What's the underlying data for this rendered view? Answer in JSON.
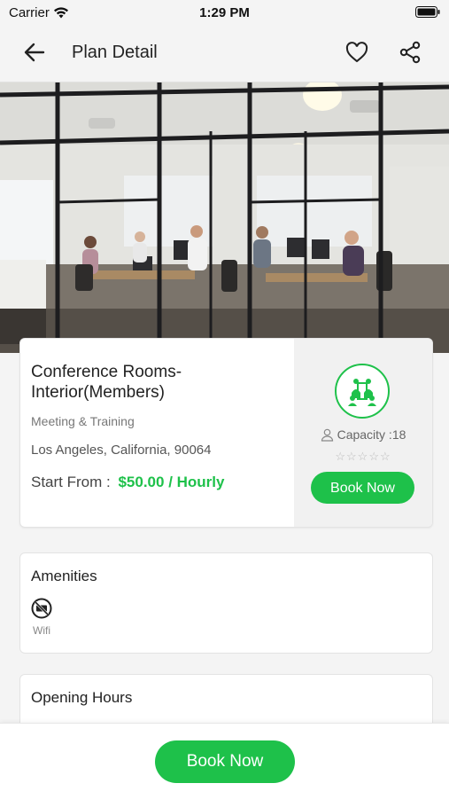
{
  "status_bar": {
    "carrier": "Carrier",
    "time": "1:29 PM"
  },
  "nav": {
    "title": "Plan Detail",
    "back_icon": "arrow-left",
    "favorite_icon": "heart-outline",
    "share_icon": "share"
  },
  "gallery": {
    "image": "office conference room photo",
    "slide_count": 2,
    "active_slide": 1
  },
  "plan": {
    "name": "Conference Rooms-Interior(Members)",
    "category": "Meeting & Training",
    "location": "Los Angeles, California, 90064",
    "price_label": "Start From :",
    "price": "$50.00 / Hourly",
    "capacity_label": "Capacity :18",
    "rating_stars": "☆☆☆☆☆",
    "rating": 0,
    "book_button": "Book Now"
  },
  "amenities": {
    "title": "Amenities",
    "items": [
      {
        "label": "Wifi",
        "icon": "wifi-off-icon"
      }
    ]
  },
  "opening_hours": {
    "title": "Opening Hours"
  },
  "footer": {
    "book_button": "Book Now"
  },
  "colors": {
    "accent": "#1ec14a",
    "background": "#f4f4f4"
  }
}
